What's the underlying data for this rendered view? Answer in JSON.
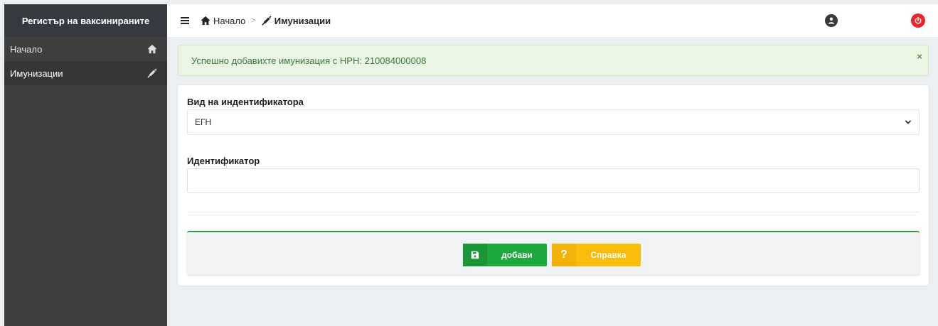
{
  "app": {
    "title": "Регистър на ваксинираните"
  },
  "sidebar": {
    "items": [
      {
        "label": "Начало",
        "icon": "home-icon"
      },
      {
        "label": "Имунизации",
        "icon": "syringe-icon"
      }
    ]
  },
  "header": {
    "breadcrumb": {
      "home": "Начало",
      "current": "Имунизации"
    }
  },
  "alert": {
    "message": "Успешно добавихте имунизация с НРН: 210084000008",
    "close": "×"
  },
  "form": {
    "id_type_label": "Вид на индентификатора",
    "id_type_value": "ЕГН",
    "id_label": "Идентификатор",
    "id_value": ""
  },
  "actions": {
    "save_label": "добави",
    "help_label": "Справка",
    "help_icon_text": "?"
  },
  "colors": {
    "save": "#1fa83e",
    "help": "#fbbd0c",
    "power": "#e8262b",
    "alert_bg": "#eaf6e3"
  }
}
